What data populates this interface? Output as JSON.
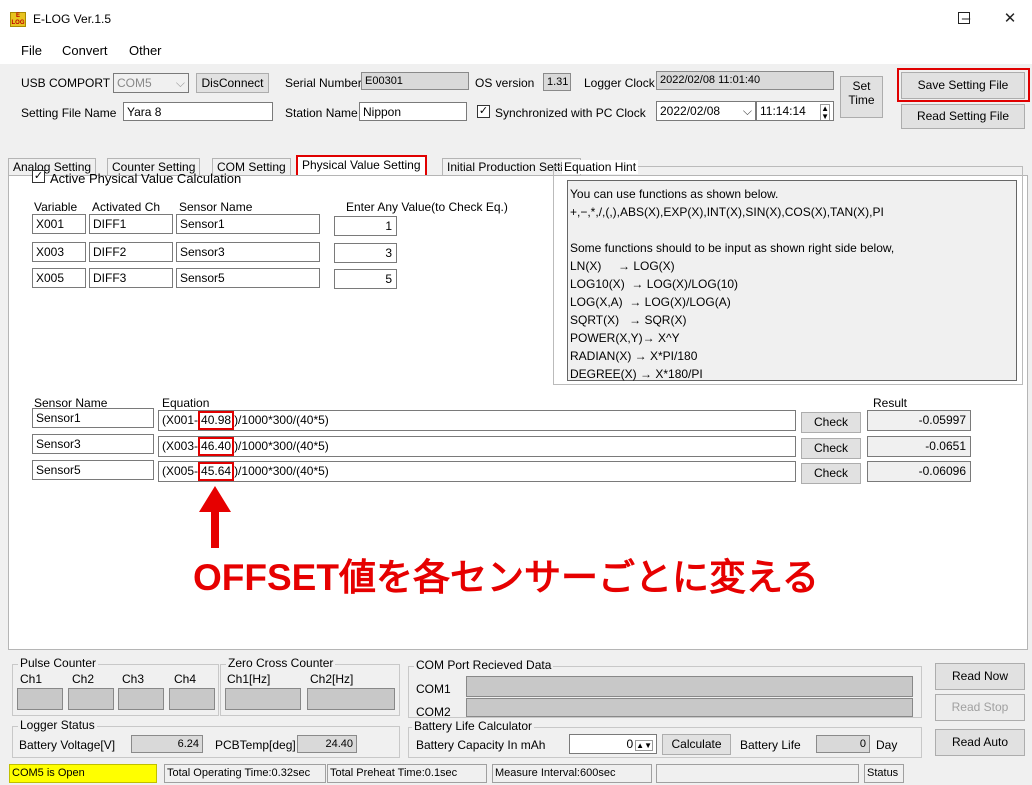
{
  "window": {
    "title": "E-LOG Ver.1.5",
    "min": "–",
    "max": "☐",
    "close": "✕"
  },
  "menu": [
    "File",
    "Convert",
    "Other"
  ],
  "header": {
    "usb_label": "USB COMPORT",
    "usb_value": "COM5",
    "disconnect": "DisConnect",
    "serial_label": "Serial Number",
    "serial_value": "E00301",
    "os_label": "OS version",
    "os_value": "1.31",
    "clock_label": "Logger Clock",
    "clock_value": "2022/02/08 11:01:40",
    "set_time": "Set Time",
    "save_setting": "Save Setting File",
    "read_setting": "Read Setting File",
    "setting_file_label": "Setting File Name",
    "setting_file_value": "Yara 8",
    "station_label": "Station Name",
    "station_value": "Nippon",
    "sync_label": "Synchronized with PC Clock",
    "sync_date": "2022/02/08",
    "sync_time": "11:14:14"
  },
  "tabs": [
    "Analog Setting",
    "Counter Setting",
    "COM Setting",
    "Physical Value Setting",
    "Initial Production Setting"
  ],
  "physical": {
    "active_label": "Active Physical Value Calculation",
    "headers": {
      "variable": "Variable",
      "activated": "Activated Ch",
      "sensor": "Sensor Name",
      "enter": "Enter Any Value(to Check Eq.)"
    },
    "rows": [
      {
        "variable": "X001",
        "ch": "DIFF1",
        "sensor": "Sensor1",
        "value": "1"
      },
      {
        "variable": "X003",
        "ch": "DIFF2",
        "sensor": "Sensor3",
        "value": "3"
      },
      {
        "variable": "X005",
        "ch": "DIFF3",
        "sensor": "Sensor5",
        "value": "5"
      }
    ],
    "hint_title": "Equation Hint",
    "hint_text": "You can use functions as shown below.\n+,−,*,/,(,),ABS(X),EXP(X),INT(X),SIN(X),COS(X),TAN(X),PI\n\nSome functions should to be input as shown right side below,\nLN(X)     → LOG(X)\nLOG10(X)  → LOG(X)/LOG(10)\nLOG(X,A)  → LOG(X)/LOG(A)\nSQRT(X)   → SQR(X)\nPOWER(X,Y)→ X^Y\nRADIAN(X) → X*PI/180\nDEGREE(X) → X*180/PI",
    "eq_headers": {
      "sensor": "Sensor Name",
      "equation": "Equation",
      "result": "Result"
    },
    "equations": [
      {
        "sensor": "Sensor1",
        "pre": "(X001-",
        "offset": "40.98",
        "post": ")/1000*300/(40*5)",
        "check": "Check",
        "result": "-0.05997"
      },
      {
        "sensor": "Sensor3",
        "pre": "(X003-",
        "offset": "46.40",
        "post": ")/1000*300/(40*5)",
        "check": "Check",
        "result": "-0.0651"
      },
      {
        "sensor": "Sensor5",
        "pre": "(X005-",
        "offset": "45.64",
        "post": ")/1000*300/(40*5)",
        "check": "Check",
        "result": "-0.06096"
      }
    ],
    "annotation": "OFFSET値を各センサーごとに変える"
  },
  "bottom": {
    "pulse_title": "Pulse Counter",
    "pulse_ch": [
      "Ch1",
      "Ch2",
      "Ch3",
      "Ch4"
    ],
    "zero_title": "Zero Cross Counter",
    "zero_ch": [
      "Ch1[Hz]",
      "Ch2[Hz]"
    ],
    "com_title": "COM Port Recieved Data",
    "com1": "COM1",
    "com2": "COM2",
    "read_now": "Read Now",
    "read_stop": "Read Stop",
    "read_auto": "Read Auto",
    "logger_title": "Logger Status",
    "battery_label": "Battery Voltage[V]",
    "battery_value": "6.24",
    "pcb_label": "PCBTemp[deg]",
    "pcb_value": "24.40",
    "blc_title": "Battery Life Calculator",
    "cap_label": "Battery Capacity In mAh",
    "cap_value": "0",
    "calculate": "Calculate",
    "life_label": "Battery Life",
    "life_value": "0",
    "day": "Day"
  },
  "status": {
    "com": "COM5 is Open",
    "op": "Total Operating Time:0.32sec",
    "pre": "Total Preheat Time:0.1sec",
    "interval": "Measure Interval:600sec",
    "status": "Status"
  },
  "colors": {
    "accent_red": "#e00000",
    "status_yellow": "#ffff00"
  }
}
